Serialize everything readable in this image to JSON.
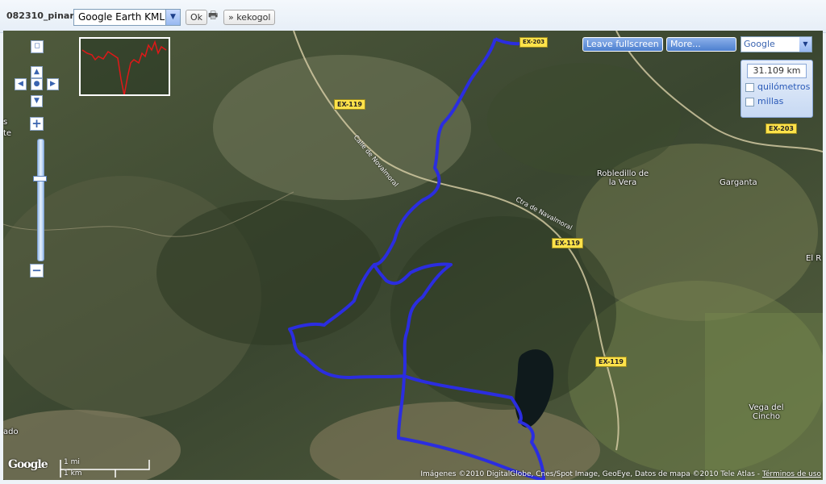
{
  "header": {
    "title": "082310_pinar",
    "format_select": {
      "value": "Google Earth KML"
    },
    "ok_label": "Ok",
    "link_label": "» kekogol"
  },
  "map": {
    "controls": {
      "leave_fullscreen": "Leave fullscreen",
      "more": "More...",
      "map_type": "Google"
    },
    "measure": {
      "distance": "31.109 km",
      "unit_km": "quilómetros",
      "unit_miles": "millas"
    },
    "road_labels": {
      "ex119_a": "EX-119",
      "ex119_b": "EX-119",
      "ex119_c": "EX-119",
      "ex203": "EX-203",
      "ex203_top": "EX-203"
    },
    "streets": {
      "calle_novalmoral": "Calle de Novalmoral",
      "ctra_navalmoral": "Ctra de Navalmoral"
    },
    "towns": {
      "robledillo": "Robledillo de la Vera",
      "garganta": "Garganta",
      "el_r": "El R",
      "vega_cincho": "Vega del Cincho",
      "left_s": "s",
      "left_te": "te",
      "left_ado": "ado"
    },
    "scale": {
      "mi": "1 mi",
      "km": "1 km"
    },
    "copyright": "Imágenes ©2010 DigitalGlobe, Cnes/Spot Image, GeoEye, Datos de mapa ©2010 Tele Atlas - ",
    "terms": "Términos de uso",
    "logo": "Google",
    "colors": {
      "track": "#2b2de0",
      "profile": "#e01818"
    }
  }
}
